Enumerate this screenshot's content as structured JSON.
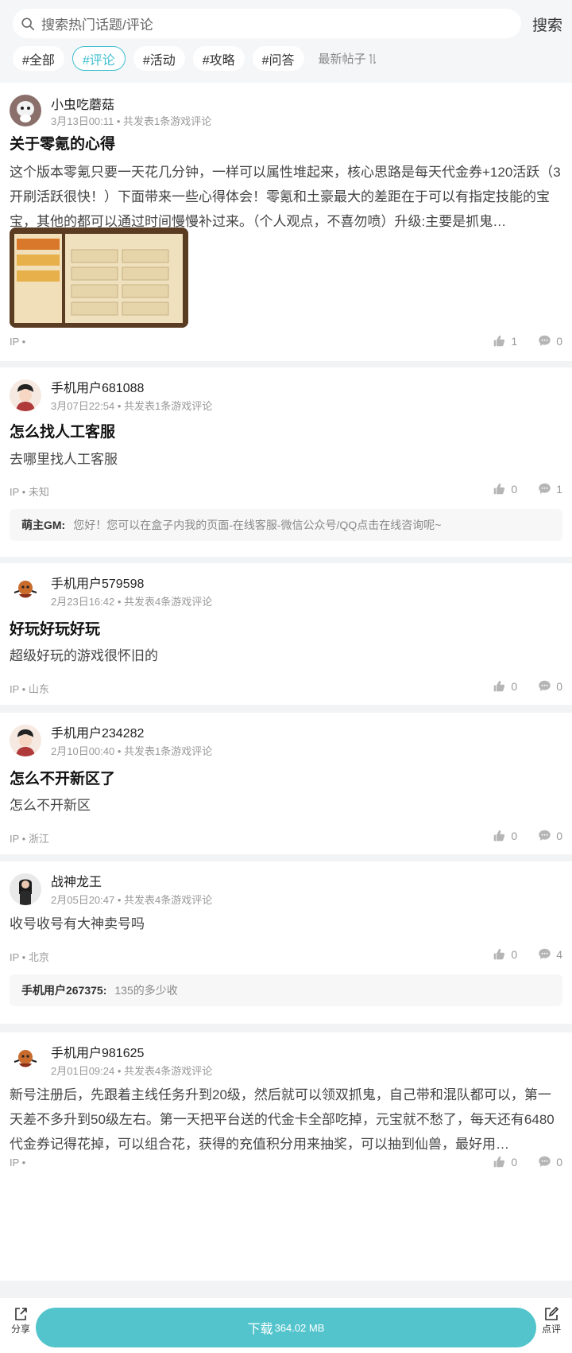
{
  "search": {
    "placeholder": "搜索热门话题/评论",
    "button": "搜索"
  },
  "filters": {
    "chips": [
      "#全部",
      "#评论",
      "#活动",
      "#攻略",
      "#问答"
    ],
    "active_index": 1,
    "sort_label": "最新帖子",
    "sort_icon": "sort-arrows-icon"
  },
  "colors": {
    "accent": "#3fbfd0",
    "download": "#53c4cc"
  },
  "posts": [
    {
      "username": "小虫吃蘑菇",
      "meta": "3月13日00:11 • 共发表1条游戏评论",
      "title": "关于零氪的心得",
      "body": "这个版本零氪只要一天花几分钟，一样可以属性堆起来，核心思路是每天代金券+120活跃（3开刷活跃很快！）下面带来一些心得体会！零氪和土豪最大的差距在于可以有指定技能的宝宝，其他的都可以通过时间慢慢补过来。（个人观点，不喜勿喷）升级:主要是抓鬼…",
      "ip": "IP •",
      "likes": "1",
      "comments": "0"
    },
    {
      "username": "手机用户681088",
      "meta": "3月07日22:54 • 共发表1条游戏评论",
      "title": "怎么找人工客服",
      "body": "去哪里找人工客服",
      "ip": "IP • 未知",
      "likes": "0",
      "comments": "1",
      "reply_author": "萌主GM:",
      "reply_text": "您好！您可以在盒子内我的页面-在线客服-微信公众号/QQ点击在线咨询呢~"
    },
    {
      "username": "手机用户579598",
      "meta": "2月23日16:42 • 共发表4条游戏评论",
      "title": "好玩好玩好玩",
      "body": "超级好玩的游戏很怀旧的",
      "ip": "IP • 山东",
      "likes": "0",
      "comments": "0"
    },
    {
      "username": "手机用户234282",
      "meta": "2月10日00:40 • 共发表1条游戏评论",
      "title": "怎么不开新区了",
      "body": "怎么不开新区",
      "ip": "IP • 浙江",
      "likes": "0",
      "comments": "0"
    },
    {
      "username": "战神龙王",
      "meta": "2月05日20:47 • 共发表4条游戏评论",
      "body": "收号收号有大神卖号吗",
      "ip": "IP • 北京",
      "likes": "0",
      "comments": "4",
      "reply_author": "手机用户267375:",
      "reply_text": "135的多少收"
    },
    {
      "username": "手机用户981625",
      "meta": "2月01日09:24 • 共发表4条游戏评论",
      "body": "新号注册后，先跟着主线任务升到20级，然后就可以领双抓鬼，自己带和混队都可以，第一天差不多升到50级左右。第一天把平台送的代金卡全部吃掉，元宝就不愁了，每天还有6480代金券记得花掉，可以组合花，获得的充值积分用来抽奖，可以抽到仙兽，最好用…",
      "ip": "IP •",
      "likes": "0",
      "comments": "0"
    }
  ],
  "bottom": {
    "share_label": "分享",
    "download_label": "下载",
    "download_size": "364.02 MB",
    "review_label": "点评"
  }
}
